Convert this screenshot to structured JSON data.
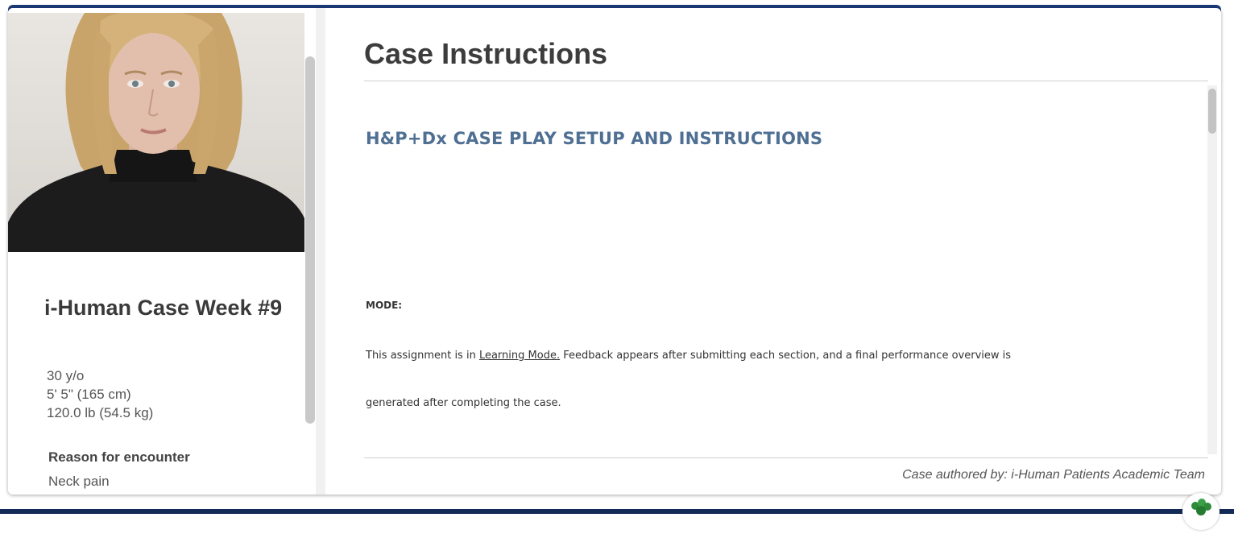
{
  "patient": {
    "name": "i-Human Case Week #9",
    "age": "30 y/o",
    "height": "5' 5\" (165 cm)",
    "weight": "120.0 lb (54.5 kg)",
    "reason_label": "Reason for encounter",
    "reason_value": "Neck pain",
    "portrait_icon": "patient-portrait"
  },
  "instructions": {
    "title": "Case Instructions",
    "heading": "H&P+Dx CASE PLAY SETUP AND INSTRUCTIONS",
    "mode_label": "MODE:",
    "para1_pre": "This assignment is in ",
    "para1_link": "Learning Mode.",
    "para1_post": " Feedback appears after submitting each section, and a final performance overview is",
    "para2": "generated after completing the case.",
    "author": "Case authored by: i-Human Patients Academic Team"
  },
  "colors": {
    "accent_bar": "#1d3a78",
    "heading": "#4f6f93",
    "help_icon": "#2e8b3a"
  }
}
